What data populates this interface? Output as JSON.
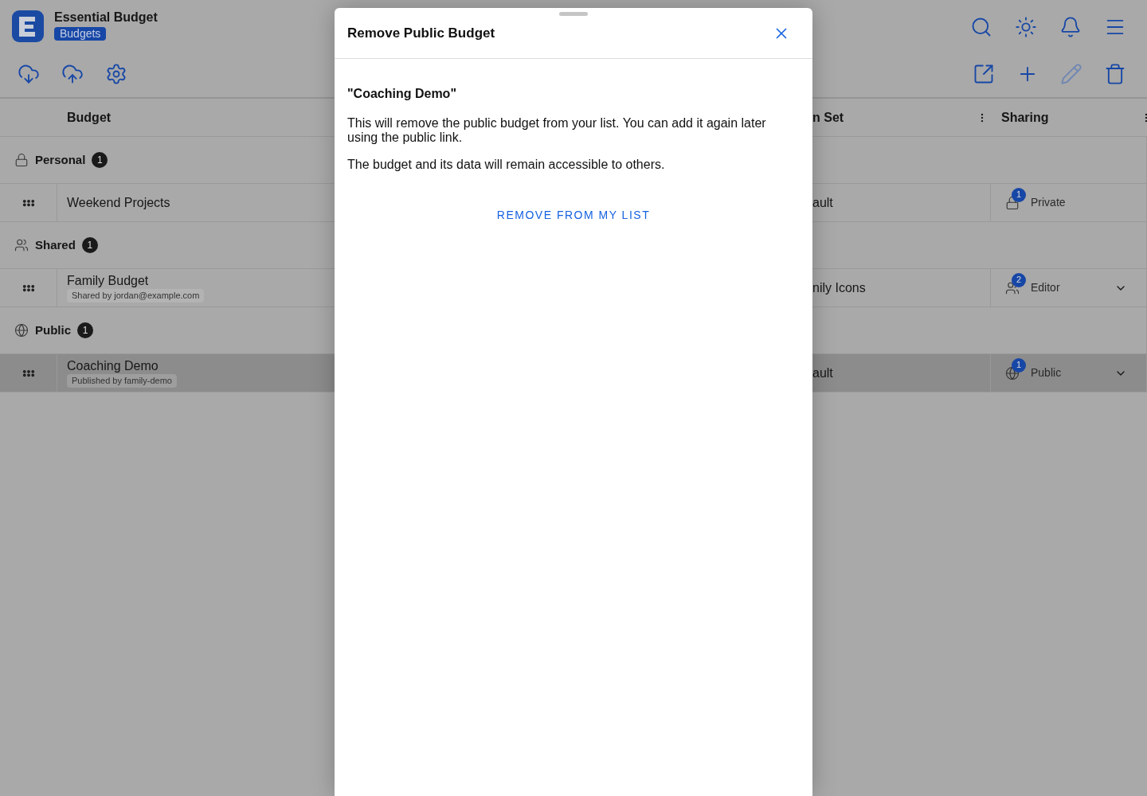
{
  "app": {
    "title": "Essential Budget",
    "badge": "Budgets"
  },
  "top_tools": [
    {
      "kind": "search",
      "disabled": false
    },
    {
      "kind": "theme",
      "disabled": false
    },
    {
      "kind": "notifications",
      "disabled": false
    },
    {
      "kind": "menu",
      "disabled": false
    }
  ],
  "left_tools": [
    {
      "kind": "download",
      "disabled": false
    },
    {
      "kind": "upload",
      "disabled": false
    },
    {
      "kind": "settings",
      "disabled": false
    }
  ],
  "right_tools": [
    {
      "kind": "open",
      "disabled": false
    },
    {
      "kind": "add",
      "disabled": false
    },
    {
      "kind": "edit",
      "disabled": true
    },
    {
      "kind": "delete",
      "disabled": false
    }
  ],
  "table": {
    "columns": [
      {
        "label": "Budget"
      },
      {
        "label": "n Set"
      },
      {
        "label": "Sharing"
      }
    ],
    "groups": [
      {
        "label": "Personal",
        "kind": "lock",
        "count": "1",
        "rows": [
          {
            "name": "Weekend Projects",
            "column_2": "ault",
            "sharing": {
              "kind": "lock",
              "count": "1",
              "label": "Private",
              "dropdown": false
            },
            "selected": false
          }
        ]
      },
      {
        "label": "Shared",
        "kind": "people",
        "count": "1",
        "rows": [
          {
            "name": "Family Budget",
            "note": "Shared by jordan@example.com",
            "column_2": "nily Icons",
            "sharing": {
              "kind": "people",
              "count": "2",
              "label": "Editor",
              "dropdown": true
            },
            "selected": false
          }
        ]
      },
      {
        "label": "Public",
        "kind": "globe",
        "count": "1",
        "rows": [
          {
            "name": "Coaching Demo",
            "note": "Published by family-demo",
            "column_2": "ault",
            "sharing": {
              "kind": "globe",
              "count": "1",
              "label": "Public",
              "dropdown": true
            },
            "selected": true
          }
        ]
      }
    ]
  },
  "dialog": {
    "title": "Remove Public Budget",
    "heading": "\"Coaching Demo\"",
    "paragraphs": [
      "This will remove the public budget from your list. You can add it again later using the public link.",
      "The budget and its data will remain accessible to others."
    ],
    "action": "REMOVE FROM MY LIST"
  }
}
